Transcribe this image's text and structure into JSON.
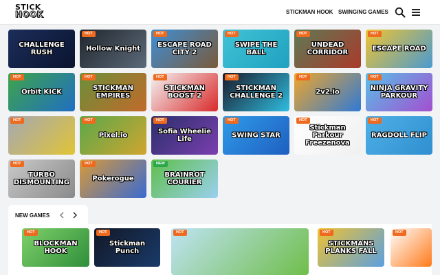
{
  "header": {
    "logo_line1": "STICK",
    "logo_line2": "HOOK",
    "nav": [
      "STICKMAN HOOK",
      "SWINGING GAMES"
    ],
    "search_icon": "search-icon",
    "menu_icon": "menu-icon"
  },
  "games": [
    {
      "title": "CHALLENGE RUSH",
      "badge": "",
      "bg": "#1b2d5a",
      "bg2": "#0b1430"
    },
    {
      "title": "Hollow Knight",
      "badge": "HOT",
      "bg": "#20262e",
      "bg2": "#5c6a78"
    },
    {
      "title": "ESCAPE ROAD CITY 2",
      "badge": "HOT",
      "bg": "#3f8fd6",
      "bg2": "#7a5a3a"
    },
    {
      "title": "SWIPE THE BALL",
      "badge": "HOT",
      "bg": "#42c3d6",
      "bg2": "#1ea1c0"
    },
    {
      "title": "UNDEAD CORRIDOR",
      "badge": "HOT",
      "bg": "#5e7a56",
      "bg2": "#aa3a2a"
    },
    {
      "title": "ESCAPE ROAD",
      "badge": "HOT",
      "bg": "#f0c431",
      "bg2": "#4a9ad0"
    },
    {
      "title": "Orbit KICK",
      "badge": "HOT",
      "bg": "#3fa44a",
      "bg2": "#1f6fc2"
    },
    {
      "title": "STICKMAN EMPIRES",
      "badge": "HOT",
      "bg": "#6a8f3a",
      "bg2": "#c26a2a"
    },
    {
      "title": "STICKMAN BOOST 2",
      "badge": "HOT",
      "bg": "#f4f4f4",
      "bg2": "#d92a2a"
    },
    {
      "title": "STICKMAN CHALLENGE 2",
      "badge": "HOT",
      "bg": "#1a1a2a",
      "bg2": "#2fbde0"
    },
    {
      "title": "2v2.io",
      "badge": "HOT",
      "bg": "#f0a62a",
      "bg2": "#2f7ad6"
    },
    {
      "title": "NINJA GRAVITY PARKOUR",
      "badge": "HOT",
      "bg": "#58c0e8",
      "bg2": "#a34fd0"
    },
    {
      "title": "",
      "badge": "HOT",
      "bg": "#a5a8b3",
      "bg2": "#e0c436"
    },
    {
      "title": "Pixel.io",
      "badge": "HOT",
      "bg": "#5aa84a",
      "bg2": "#d0a530"
    },
    {
      "title": "Sofia Wheelie Life",
      "badge": "HOT",
      "bg": "#2a2f6a",
      "bg2": "#7a3fb0"
    },
    {
      "title": "SWING STAR",
      "badge": "HOT",
      "bg": "#2f9be8",
      "bg2": "#1f5fc0"
    },
    {
      "title": "Stickman Parkour Freezenova",
      "badge": "HOT",
      "bg": "#ffffff",
      "bg2": "#f0f0f0"
    },
    {
      "title": "RAGDOLL FLIP",
      "badge": "HOT",
      "bg": "#4fb0e6",
      "bg2": "#2f8fd0"
    },
    {
      "title": "TURBO DISMOUNTING",
      "badge": "HOT",
      "bg": "#c9c9c9",
      "bg2": "#8a8a8a"
    },
    {
      "title": "Pokerogue",
      "badge": "HOT",
      "bg": "#d89a3a",
      "bg2": "#3a6ad0"
    },
    {
      "title": "BRAINROT COURIER",
      "badge": "NEW",
      "bg": "#5fbe4a",
      "bg2": "#9ad0f0"
    }
  ],
  "new_games": {
    "title": "NEW GAMES",
    "prev_icon": "chevron-left-icon",
    "next_icon": "chevron-right-icon",
    "items": [
      {
        "title": "BLOCKMAN HOOK",
        "badge": "HOT",
        "bg": "#7fd06a",
        "bg2": "#2f8f3a"
      },
      {
        "title": "Stickman Punch",
        "badge": "HOT",
        "bg": "#121826",
        "bg2": "#1a3a6a"
      },
      {
        "title": "",
        "badge": "HOT",
        "bg": "#bfe3f4",
        "bg2": "#6fbe4a"
      },
      {
        "title": "STICKMANS PLANKS FALL",
        "badge": "HOT",
        "bg": "#f0c231",
        "bg2": "#5aa0e0"
      },
      {
        "title": "",
        "badge": "HOT",
        "bg": "#ffffff",
        "bg2": "#ff7a1a"
      }
    ]
  }
}
